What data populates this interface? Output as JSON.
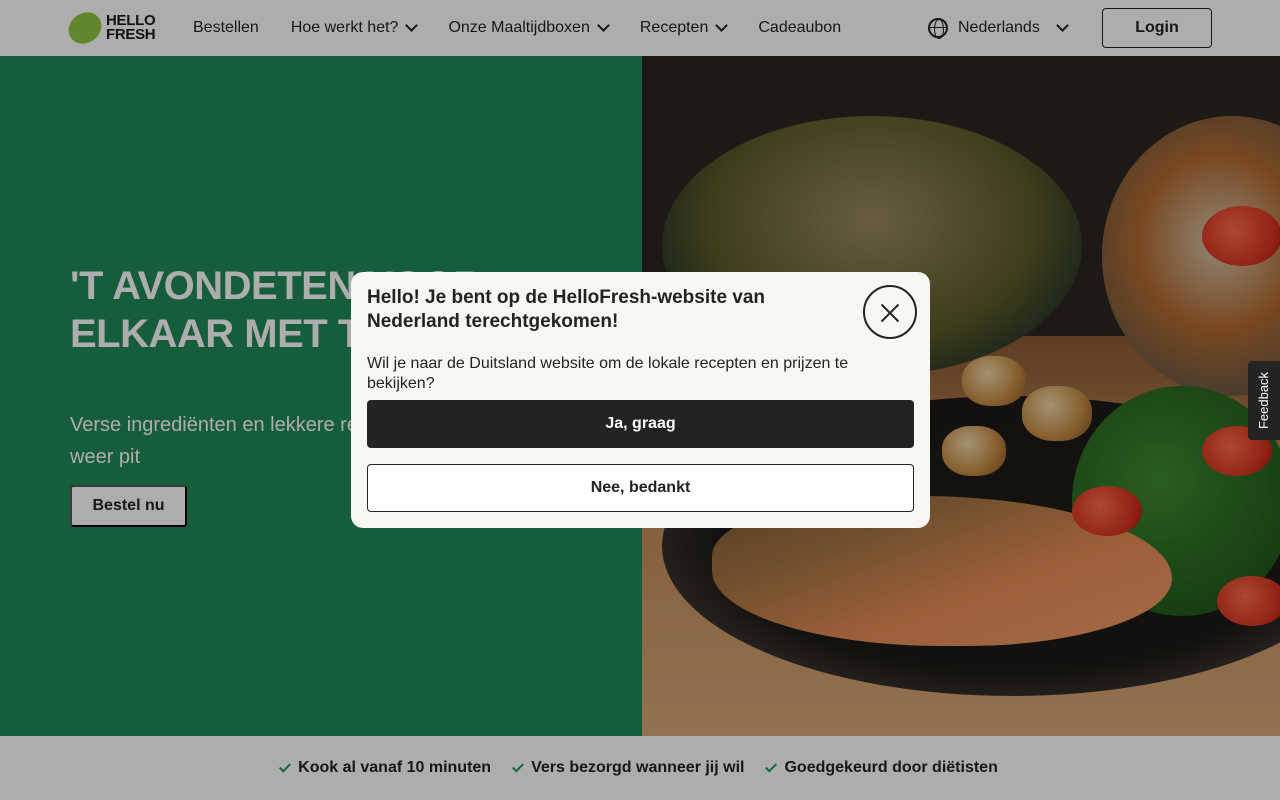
{
  "header": {
    "logo_line1": "HELLO",
    "logo_line2": "FRESH",
    "nav": [
      {
        "label": "Bestellen",
        "has_dropdown": false
      },
      {
        "label": "Hoe werkt het?",
        "has_dropdown": true
      },
      {
        "label": "Onze Maaltijdboxen",
        "has_dropdown": true
      },
      {
        "label": "Recepten",
        "has_dropdown": true
      },
      {
        "label": "Cadeaubon",
        "has_dropdown": false
      }
    ],
    "language": "Nederlands",
    "login_label": "Login"
  },
  "hero": {
    "title": "'T AVONDETEN VOOR ELKAAR MET TOT KORTING",
    "subtitle": "Verse ingrediënten en lekkere rec doordeweekse avonden weer pit",
    "cta_label": "Bestel nu"
  },
  "benefits": [
    "Kook al vanaf 10 minuten",
    "Vers bezorgd wanneer jij wil",
    "Goedgekeurd door diëtisten"
  ],
  "modal": {
    "title": "Hello! Je bent op de HelloFresh-website van Nederland terechtgekomen!",
    "text": "Wil je naar de Duitsland website om de lokale recepten en prijzen te bekijken?",
    "confirm_label": "Ja, graag",
    "decline_label": "Nee, bedankt"
  },
  "feedback_label": "Feedback",
  "colors": {
    "brand_green": "#1f8a57",
    "dark": "#232323",
    "check_green": "#1b9a5a",
    "modal_bg": "#f8f7f1"
  }
}
